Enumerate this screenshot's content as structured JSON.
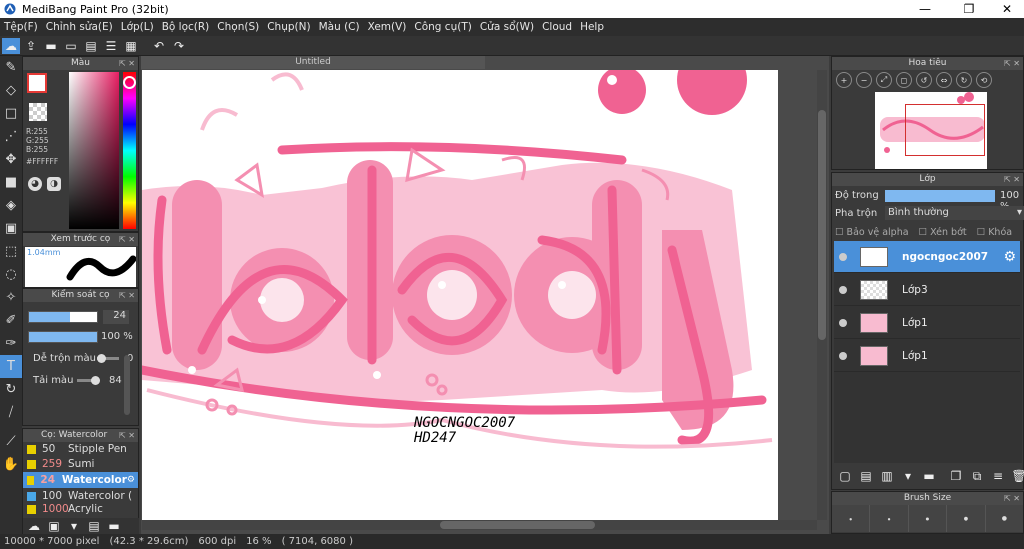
{
  "window": {
    "title": "MediBang Paint Pro (32bit)",
    "minimize": "—",
    "restore": "❐",
    "close": "✕"
  },
  "menu": [
    "Tệp(F)",
    "Chỉnh sửa(E)",
    "Lớp(L)",
    "Bộ lọc(R)",
    "Chọn(S)",
    "Chụp(N)",
    "Màu (C)",
    "Xem(V)",
    "Công cụ(T)",
    "Cửa sổ(W)",
    "Cloud",
    "Help"
  ],
  "color_panel": {
    "title": "Màu",
    "r": "R:255",
    "g": "G:255",
    "b": "B:255",
    "hex": "#FFFFFF"
  },
  "preview_panel": {
    "title": "Xem trước cọ",
    "size": "1.04mm"
  },
  "brush_control": {
    "title": "Kiểm soát cọ",
    "size_value": "24",
    "size_fill": 0.6,
    "opacity_value": "100 %",
    "mix_label": "Dễ trộn màu",
    "mix_value": "0",
    "amount_label": "Tải màu",
    "amount_value": "84"
  },
  "brush_list": {
    "title": "Cọ: Watercolor",
    "items": [
      {
        "num": "50",
        "name": "Stipple Pen",
        "color": "#e8d000"
      },
      {
        "num": "259",
        "name": "Sumi",
        "color": "#e8d000"
      },
      {
        "num": "24",
        "name": "Watercolor",
        "color": "#e8d000",
        "selected": true
      },
      {
        "num": "100",
        "name": "Watercolor (",
        "color": "#4aa8e8"
      },
      {
        "num": "1000",
        "name": "Acrylic",
        "color": "#e8d000"
      }
    ]
  },
  "document": {
    "tab": "Untitled",
    "watermark_line1": "NGOCNGOC2007",
    "watermark_line2": "HD247"
  },
  "navigator": {
    "title": "Hoa tiêu"
  },
  "layer_panel": {
    "title": "Lớp",
    "opacity_label": "Độ trong",
    "opacity_value": "100 %",
    "blend_label": "Pha trộn",
    "blend_value": "Bình thường",
    "protect_alpha": "Bảo vệ alpha",
    "clipping": "Xén bớt",
    "lock": "Khóa",
    "layers": [
      {
        "name": "ngocngoc2007",
        "selected": true
      },
      {
        "name": "Lớp3",
        "selected": false
      },
      {
        "name": "Lớp1",
        "selected": false
      },
      {
        "name": "Lớp1",
        "selected": false
      }
    ]
  },
  "brush_size_panel": {
    "title": "Brush Size"
  },
  "status": {
    "size": "10000 * 7000 pixel",
    "cm": "(42.3 * 29.6cm)",
    "dpi": "600 dpi",
    "zoom": "16 %",
    "coords": "( 7104, 6080 )"
  },
  "colors": {
    "accent": "#4a90d9",
    "pink": "#f48fb1",
    "deep_pink": "#f06292",
    "light_pink": "#f8bbd0"
  }
}
